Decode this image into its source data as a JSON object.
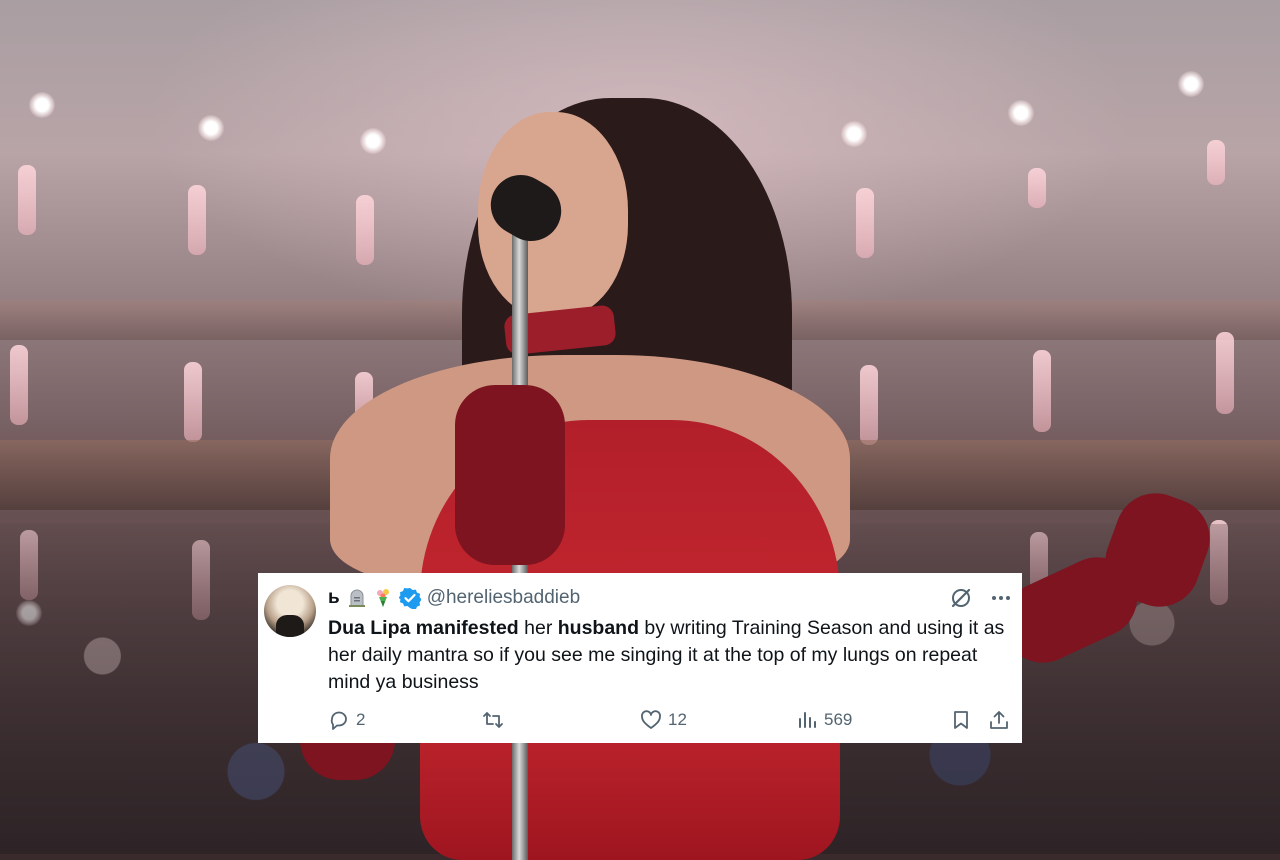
{
  "background": {
    "description_icon": "concert-hall-photo"
  },
  "tweet": {
    "display_name": "ь",
    "emojis": [
      "headstone-icon",
      "bouquet-icon"
    ],
    "verified_icon": "verified-badge-icon",
    "handle": "@hereliesbaddieb",
    "body_parts": [
      {
        "text": "Dua Lipa manifested",
        "bold": true
      },
      {
        "text": " her ",
        "bold": false
      },
      {
        "text": "husband",
        "bold": true
      },
      {
        "text": " by writing Training Season and using it as her daily mantra so if you see me singing it at the top of my lungs on repeat mind ya business",
        "bold": false
      }
    ],
    "actions": {
      "reply_count": "2",
      "retweet_count": "",
      "like_count": "12",
      "views_count": "569"
    },
    "colors": {
      "verified": "#1d9bf0",
      "muted": "#536471",
      "text": "#0f1419"
    }
  }
}
